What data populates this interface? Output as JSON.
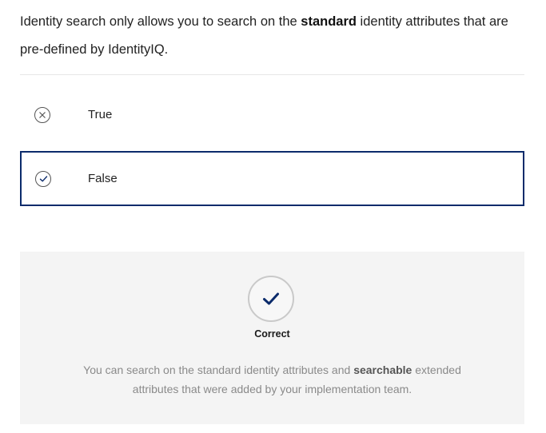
{
  "question": {
    "text_before": "Identity search only allows you to search on the ",
    "text_bold": "standard",
    "text_after": " identity attributes that are pre-defined by IdentityIQ."
  },
  "options": [
    {
      "label": "True",
      "icon": "x-circle-icon",
      "selected": false
    },
    {
      "label": "False",
      "icon": "check-circle-icon",
      "selected": true
    }
  ],
  "feedback": {
    "icon": "checkmark-icon",
    "result_label": "Correct",
    "explanation_before": "You can search on the standard identity attributes and ",
    "explanation_bold": "searchable",
    "explanation_after": " extended attributes that were added by your implementation team."
  },
  "colors": {
    "accent": "#0b2b6b",
    "feedback_background": "#f4f4f4",
    "explanation_text": "#8a8a8a"
  }
}
